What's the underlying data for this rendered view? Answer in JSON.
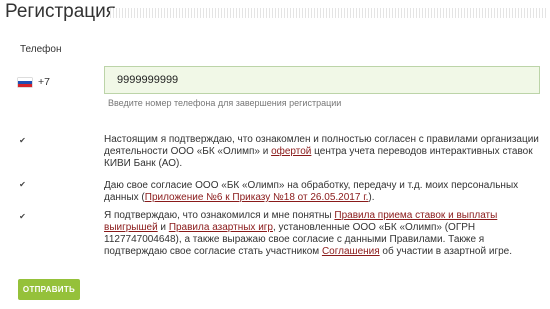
{
  "header": {
    "title": "Регистрация"
  },
  "phone": {
    "label": "Телефон",
    "country_code": "+7",
    "flag_icon": "russia-flag-icon",
    "value": "9999999999",
    "hint": "Введите номер телефона для завершения регистрации"
  },
  "agreements": [
    {
      "checked": true,
      "p1": "Настоящим я подтверждаю, что ознакомлен и полностью согласен с правилами организации деятельности ООО «БК «Олимп» и ",
      "link1": "офертой",
      "p2": " центра учета переводов интерактивных ставок КИВИ Банк (АО)."
    },
    {
      "checked": true,
      "p1": "Даю свое согласие ООО «БК «Олимп» на обработку, передачу и т.д. моих персональных данных (",
      "link1": "Приложение №6 к Приказу №18 от 26.05.2017 г.",
      "p2": ")."
    },
    {
      "checked": true,
      "p1": "Я подтверждаю, что ознакомился и мне понятны ",
      "link1": "Правила приема ставок и выплаты выигрышей",
      "p2": " и ",
      "link2": "Правила азартных игр",
      "p3": ", установленные ООО «БК «Олимп» (ОГРН 1127747004648), а также выражаю свое согласие с данными Правилами. Также я подтверждаю свое согласие стать участником ",
      "link3": "Соглашения",
      "p4": " об участии в азартной игре."
    }
  ],
  "submit_label": "ОТПРАВИТЬ",
  "colors": {
    "accent": "#95c13a",
    "input_bg": "#f1f8e7",
    "link": "#8a1a1a"
  }
}
